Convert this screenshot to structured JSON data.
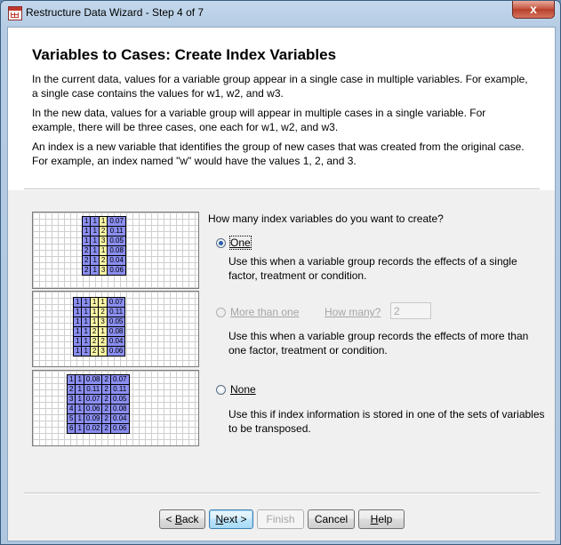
{
  "window": {
    "title": "Restructure Data Wizard - Step 4 of 7",
    "close_glyph": "x"
  },
  "header": {
    "heading": "Variables to Cases: Create Index Variables",
    "paragraphs": [
      "In the current data, values for a variable group appear in a single case in multiple variables.  For example, a single case contains the values for w1, w2, and w3.",
      "In the new data, values for a variable group will appear in multiple cases in a single variable.  For example, there will be three cases, one each for w1, w2, and w3.",
      "An index is a new variable that identifies the group of new cases that was created from the original case.  For example, an index named \"w\" would have the values 1, 2, and 3."
    ]
  },
  "illustrations": [
    {
      "rows": [
        [
          "1",
          "1",
          "1",
          "0.07"
        ],
        [
          "1",
          "1",
          "2",
          "0.11"
        ],
        [
          "1",
          "1",
          "3",
          "0.05"
        ],
        [
          "2",
          "1",
          "1",
          "0.08"
        ],
        [
          "2",
          "1",
          "2",
          "0.04"
        ],
        [
          "2",
          "1",
          "3",
          "0.06"
        ]
      ],
      "colors": [
        "blue",
        "blue",
        "yellow",
        "blue"
      ]
    },
    {
      "rows": [
        [
          "1",
          "1",
          "1",
          "1",
          "0.07"
        ],
        [
          "1",
          "1",
          "1",
          "2",
          "0.11"
        ],
        [
          "1",
          "1",
          "1",
          "3",
          "0.05"
        ],
        [
          "1",
          "1",
          "2",
          "1",
          "0.08"
        ],
        [
          "1",
          "1",
          "2",
          "2",
          "0.04"
        ],
        [
          "1",
          "1",
          "2",
          "3",
          "0.06"
        ]
      ],
      "colors": [
        "blue",
        "blue",
        "yellow",
        "yellow",
        "blue"
      ]
    },
    {
      "rows": [
        [
          "1",
          "1",
          "0.08",
          "2",
          "0.07"
        ],
        [
          "2",
          "1",
          "0.11",
          "2",
          "0.11"
        ],
        [
          "3",
          "1",
          "0.07",
          "2",
          "0.05"
        ],
        [
          "4",
          "1",
          "0.06",
          "2",
          "0.08"
        ],
        [
          "5",
          "1",
          "0.09",
          "2",
          "0.04"
        ],
        [
          "6",
          "1",
          "0.02",
          "2",
          "0.06"
        ]
      ],
      "colors": [
        "blue",
        "blue",
        "blue",
        "blue",
        "blue"
      ]
    }
  ],
  "question": "How many index variables do you want to create?",
  "options": {
    "one": {
      "label": "One",
      "selected": true,
      "description": "Use this when a variable group records the effects of a single factor, treatment or condition."
    },
    "more": {
      "label": "More than one",
      "enabled": false,
      "how_many_label": "How many?",
      "how_many_value": "2",
      "description": "Use this when a variable group records the effects of more than one factor, treatment or condition."
    },
    "none": {
      "label": "None",
      "description": "Use this if index information is stored in one of the sets of variables to be transposed."
    }
  },
  "buttons": {
    "back": "< Back",
    "next": "Next >",
    "finish": "Finish",
    "cancel": "Cancel",
    "help": "Help"
  },
  "colors": {
    "illustration_blue": "#8a8ef0",
    "illustration_yellow": "#fbf6a6",
    "close_button": "#c75a46"
  }
}
